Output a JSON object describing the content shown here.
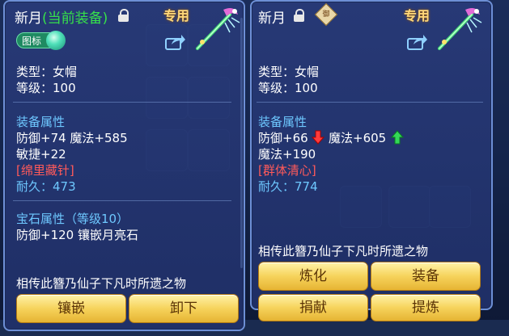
{
  "left": {
    "title_name": "新月",
    "title_status": "(当前装备)",
    "badge": "专用",
    "icon_toggle_label": "图标",
    "type": "类型：女帽",
    "level": "等级：100",
    "attr_header": "装备属性",
    "attr_line1": "防御+74 魔法+585",
    "attr_line2": "敏捷+22",
    "skill": "[绵里藏针]",
    "durability": "耐久：473",
    "gem_header": "宝石属性（等级10）",
    "gem_line": "防御+120 镶嵌月亮石",
    "description": "相传此簪乃仙子下凡时所遗之物",
    "btn_inlay": "镶嵌",
    "btn_unequip": "卸下"
  },
  "right": {
    "title_name": "新月",
    "seal": "御",
    "badge": "专用",
    "type": "类型：女帽",
    "level": "等级：100",
    "attr_header": "装备属性",
    "attr_def": "防御+66",
    "attr_mag": "魔法+605",
    "attr_line2": "魔法+190",
    "skill": "[群体清心]",
    "durability": "耐久：774",
    "description": "相传此簪乃仙子下凡时所遗之物",
    "btn_refine": "炼化",
    "btn_equip": "装备",
    "btn_donate": "捐献",
    "btn_extract": "提炼"
  },
  "colors": {
    "green": "#36e24a",
    "blue": "#6ec8ff",
    "red": "#ff5a5a",
    "gold": "#f6d35c"
  }
}
